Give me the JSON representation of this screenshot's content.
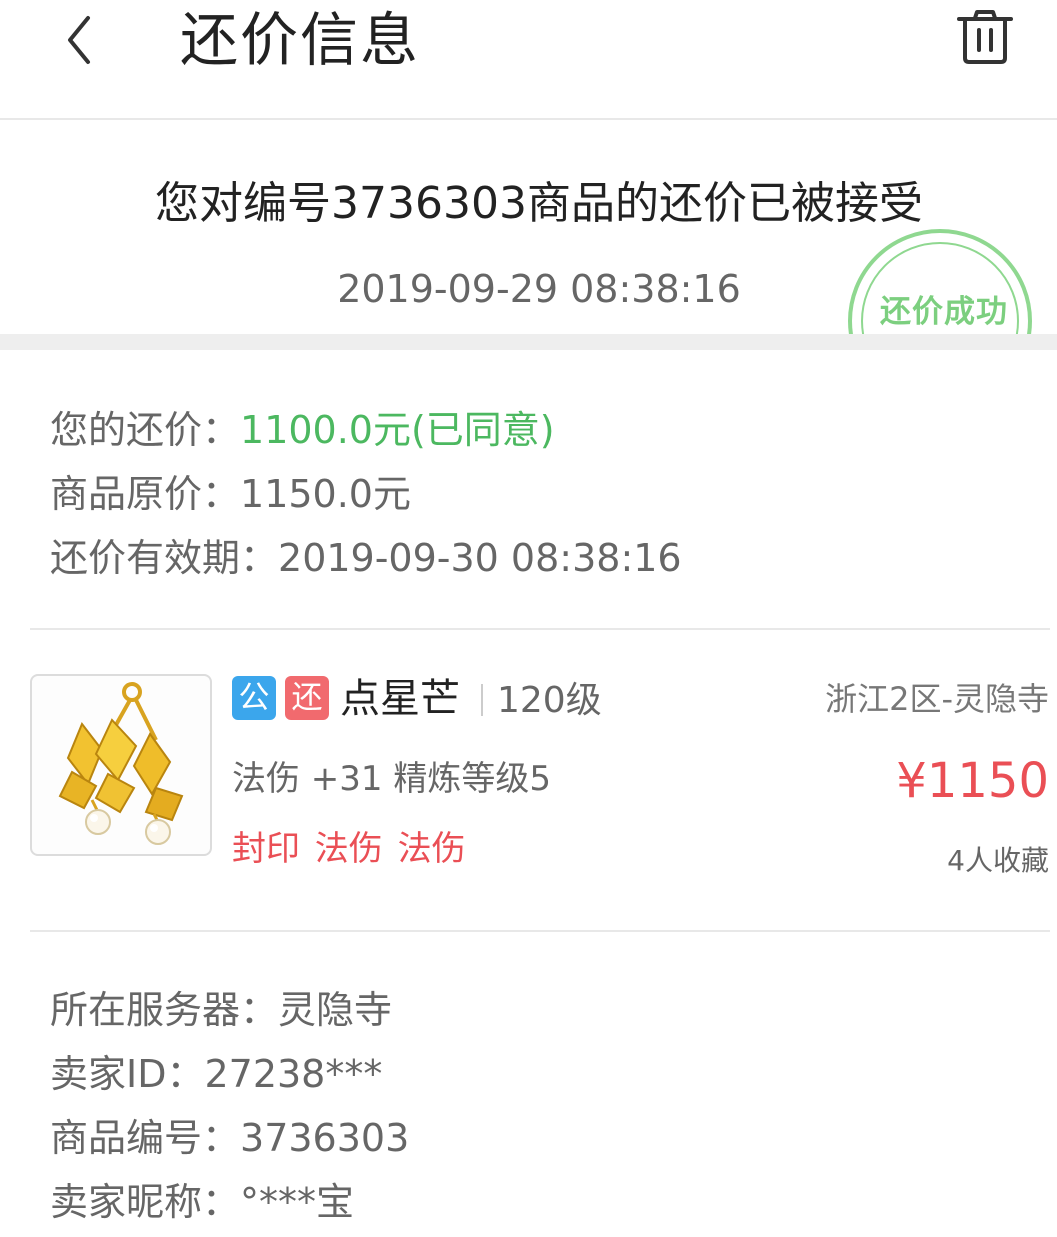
{
  "header": {
    "title": "还价信息",
    "back_icon": "chevron-left-icon",
    "delete_icon": "trash-icon"
  },
  "notice": {
    "title": "您对编号3736303商品的还价已被接受",
    "time": "2019-09-29 08:38:16",
    "stamp_text": "还价成功",
    "stamp_color": "#7ccf7f"
  },
  "price_info": {
    "offer_label": "您的还价：",
    "offer_value": "1100.0元(已同意)",
    "original_label": "商品原价：",
    "original_value": "1150.0元",
    "expire_label": "还价有效期：",
    "expire_value": "2019-09-30 08:38:16"
  },
  "product": {
    "badge_public": "公",
    "badge_counter": "还",
    "name": "点星芒",
    "level": "120级",
    "server_area": "浙江2区-灵隐寺",
    "attributes": "法伤 +31 精炼等级5",
    "price": "¥1150",
    "tags": "封印 法伤 法伤",
    "favorites": "4人收藏",
    "image_icon": "golden-earring-icon"
  },
  "seller_info": {
    "server_label": "所在服务器：",
    "server_value": "灵隐寺",
    "seller_id_label": "卖家ID：",
    "seller_id_value": "27238***",
    "item_no_label": "商品编号：",
    "item_no_value": "3736303",
    "nickname_label": "卖家昵称：",
    "nickname_value": "°***宝"
  },
  "colors": {
    "accent_green": "#4cb860",
    "price_red": "#ea4f55",
    "badge_blue": "#3ba6ec",
    "badge_red": "#f16a6e"
  }
}
